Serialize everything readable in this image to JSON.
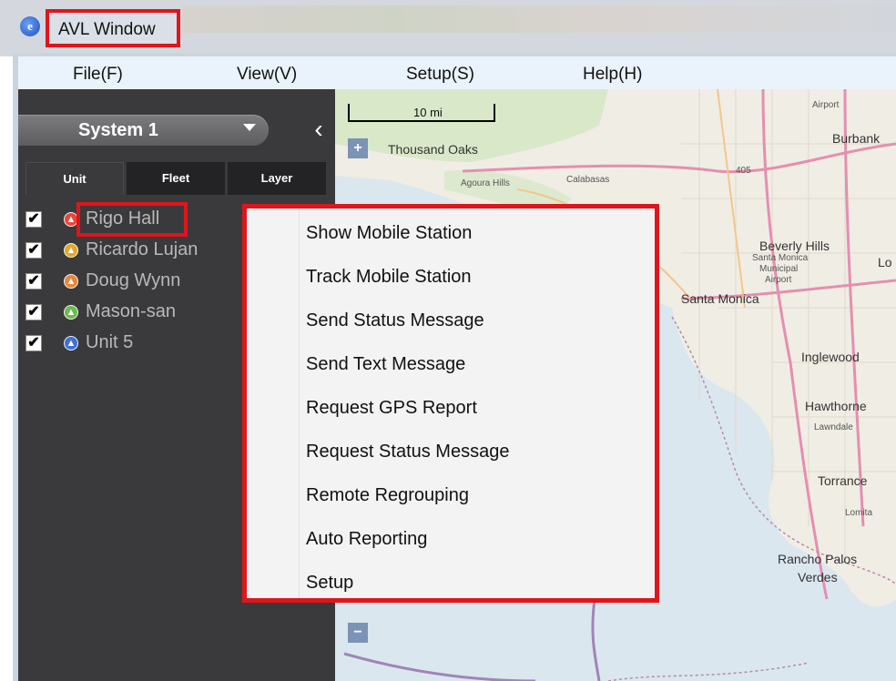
{
  "window": {
    "title": "AVL Window",
    "app_icon": "avl-logo-icon"
  },
  "menubar": {
    "items": [
      "File(F)",
      "View(V)",
      "Setup(S)",
      "Help(H)"
    ]
  },
  "sidebar": {
    "system_select": "System 1",
    "collapse_icon": "chevron-left-icon",
    "tabs": [
      "Unit",
      "Fleet",
      "Layer"
    ],
    "units": [
      {
        "name": "Rigo Hall",
        "checked": true,
        "color": "#e8473a"
      },
      {
        "name": "Ricardo Lujan",
        "checked": true,
        "color": "#e2a72a"
      },
      {
        "name": "Doug Wynn",
        "checked": true,
        "color": "#e8873a"
      },
      {
        "name": "Mason-san",
        "checked": true,
        "color": "#6cba4c"
      },
      {
        "name": "Unit 5",
        "checked": true,
        "color": "#3f6fd8"
      }
    ]
  },
  "map": {
    "scale": "10 mi",
    "zoom_in": "+",
    "zoom_out": "−",
    "labels": [
      "Thousand Oaks",
      "Agoura Hills",
      "Calabasas",
      "Burbank",
      "Beverly Hills",
      "Santa Monica",
      "Inglewood",
      "Hawthorne",
      "Lawndale",
      "Torrance",
      "Lomita",
      "Rancho Palos",
      "Verdes",
      "Airport",
      "Santa Monica",
      "Municipal",
      "Airport",
      "Lo",
      "405"
    ]
  },
  "context_menu": {
    "items": [
      "Show Mobile Station",
      "Track Mobile Station",
      "Send Status Message",
      "Send Text Message",
      "Request GPS Report",
      "Request Status Message",
      "Remote Regrouping",
      "Auto Reporting",
      "Setup"
    ]
  },
  "colors": {
    "highlight": "#e0151b",
    "panel": "#3a3a3c",
    "menubar": "#eaf3fb"
  }
}
